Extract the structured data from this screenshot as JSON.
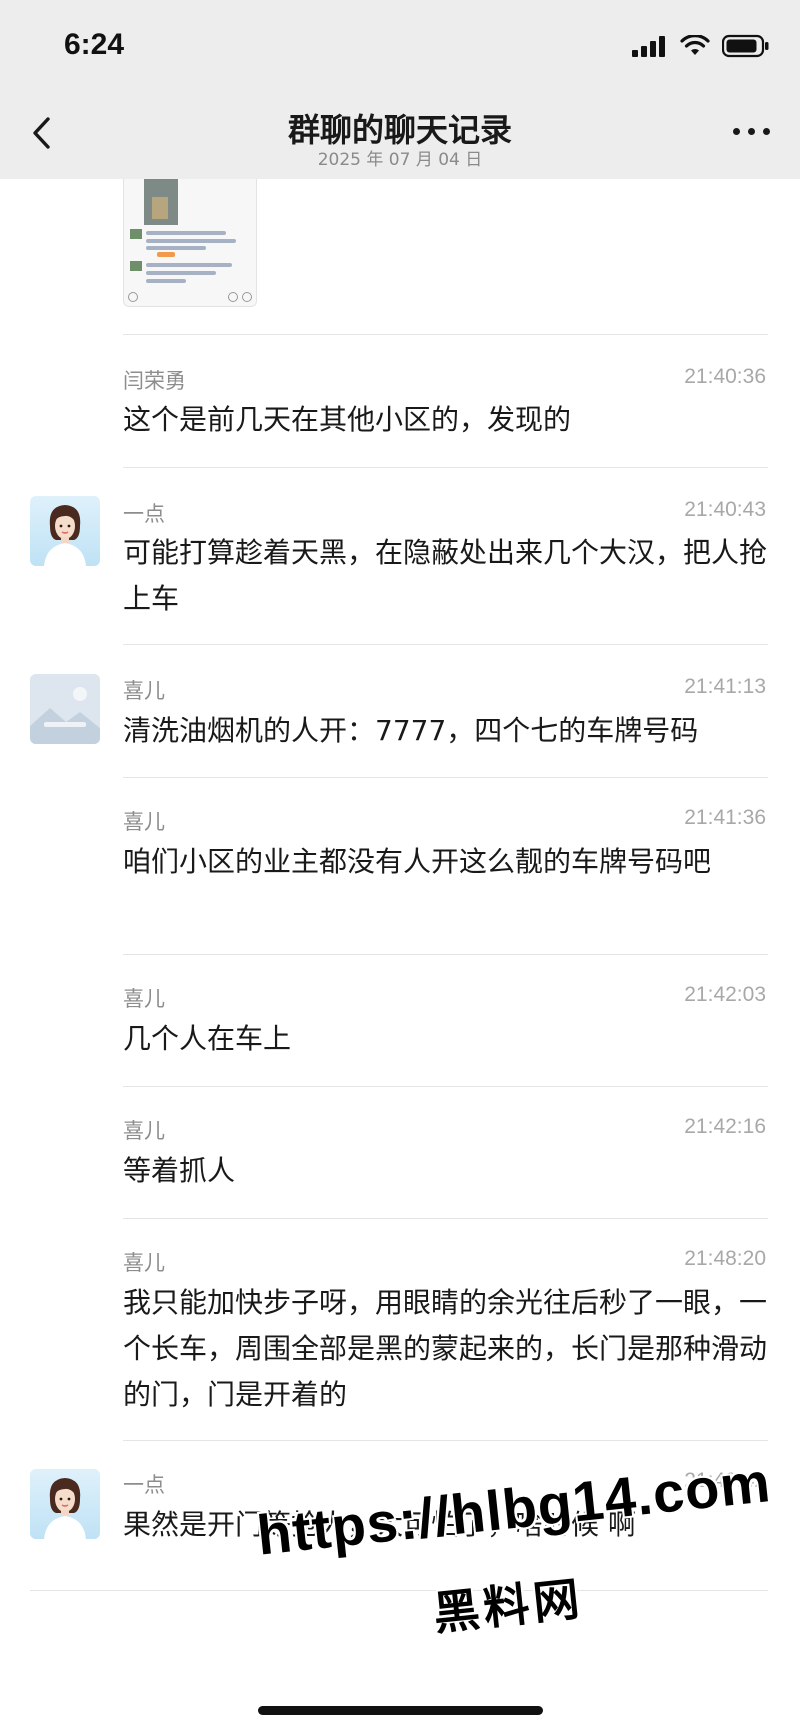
{
  "status": {
    "time": "6:24"
  },
  "header": {
    "title": "群聊的聊天记录",
    "date": "2025 年 07 月 04 日"
  },
  "messages": [
    {
      "sender": "闫荣勇",
      "time": "21:40:36",
      "text": "这个是前几天在其他小区的，发现的",
      "avatar": "none"
    },
    {
      "sender": "一点",
      "time": "21:40:43",
      "text": "可能打算趁着天黑，在隐蔽处出来几个大汉，把人抢上车",
      "avatar": "woman-portrait"
    },
    {
      "sender": "喜儿",
      "time": "21:41:13",
      "text": "清洗油烟机的人开：7777，四个七的车牌号码",
      "avatar": "placeholder-image"
    },
    {
      "sender": "喜儿",
      "time": "21:41:36",
      "text": "咱们小区的业主都没有人开这么靓的车牌号码吧",
      "avatar": "none"
    },
    {
      "sender": "喜儿",
      "time": "21:42:03",
      "text": "几个人在车上",
      "avatar": "none"
    },
    {
      "sender": "喜儿",
      "time": "21:42:16",
      "text": "等着抓人",
      "avatar": "none"
    },
    {
      "sender": "喜儿",
      "time": "21:48:20",
      "text": "我只能加快步子呀，用眼睛的余光往后秒了一眼，一个长车，周围全部是黑的蒙起来的，长门是那种滑动的门，门是开着的",
      "avatar": "none"
    },
    {
      "sender": "一点",
      "time": "21:49:42",
      "text": "果然是开门等抢人，太可怕了，啥时候 啊",
      "avatar": "woman-portrait"
    }
  ],
  "watermark": {
    "url": "https://hlbg14.com",
    "label": "黑料网"
  }
}
